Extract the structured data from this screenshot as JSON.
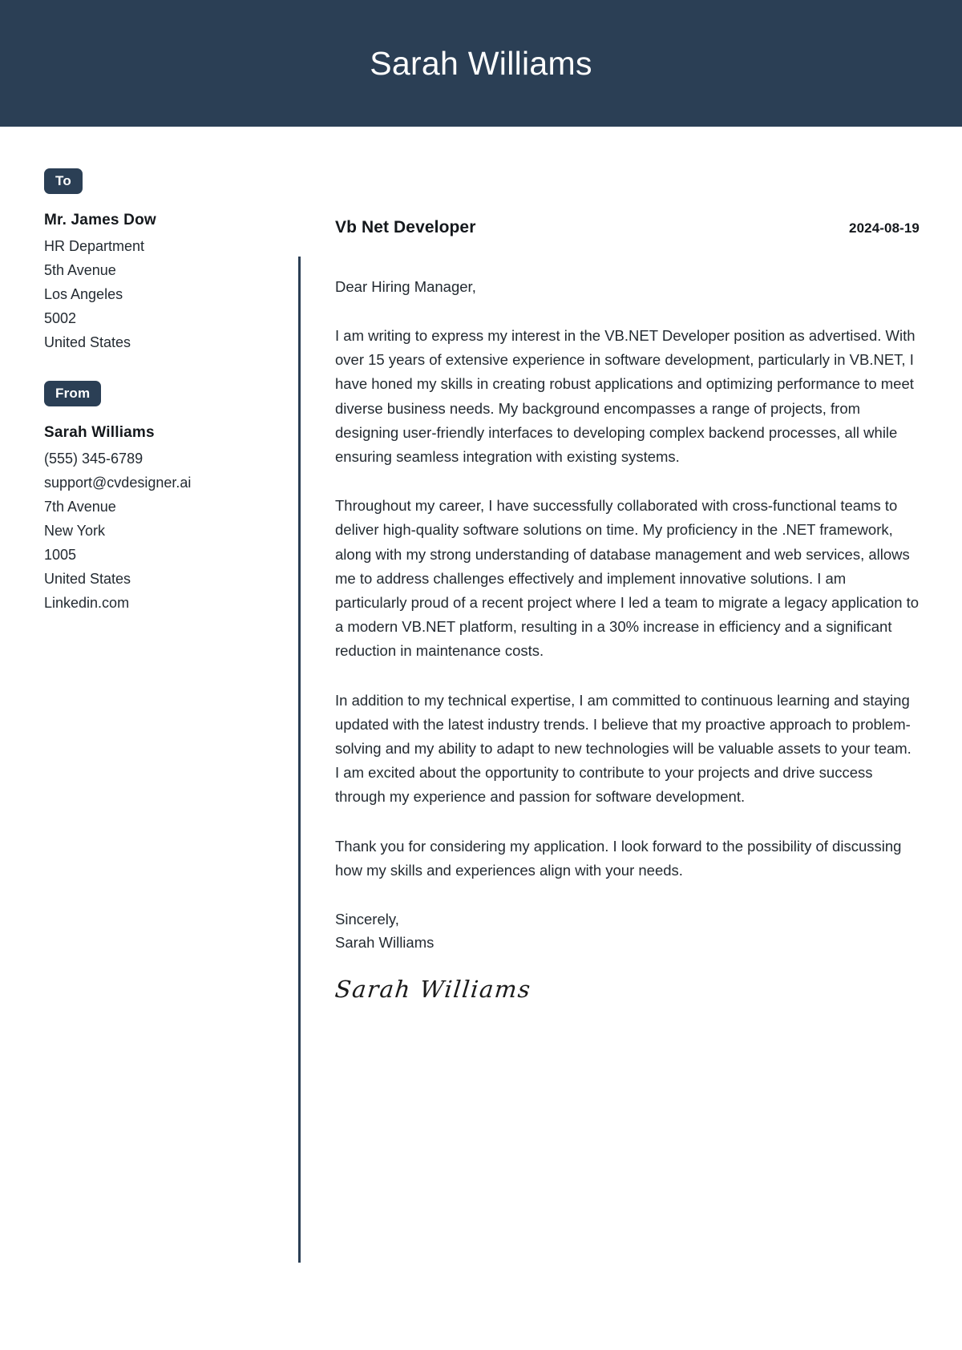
{
  "header": {
    "name": "Sarah Williams",
    "background_color": "#2b3f55",
    "text_color": "#ffffff"
  },
  "sidebar": {
    "to": {
      "badge_label": "To",
      "name": "Mr. James Dow",
      "lines": [
        "HR Department",
        "5th Avenue",
        "Los Angeles",
        "5002",
        "United States"
      ]
    },
    "from": {
      "badge_label": "From",
      "name": "Sarah Williams",
      "lines": [
        "(555) 345-6789",
        "support@cvdesigner.ai",
        "7th Avenue",
        "New York",
        "1005",
        "United States",
        "Linkedin.com"
      ]
    }
  },
  "letter": {
    "job_title": "Vb Net Developer",
    "date": "2024-08-19",
    "salutation": "Dear Hiring Manager,",
    "paragraphs": [
      "I am writing to express my interest in the VB.NET Developer position as advertised. With over 15 years of extensive experience in software development, particularly in VB.NET, I have honed my skills in creating robust applications and optimizing performance to meet diverse business needs. My background encompasses a range of projects, from designing user-friendly interfaces to developing complex backend processes, all while ensuring seamless integration with existing systems.",
      "Throughout my career, I have successfully collaborated with cross-functional teams to deliver high-quality software solutions on time. My proficiency in the .NET framework, along with my strong understanding of database management and web services, allows me to address challenges effectively and implement innovative solutions. I am particularly proud of a recent project where I led a team to migrate a legacy application to a modern VB.NET platform, resulting in a 30% increase in efficiency and a significant reduction in maintenance costs.",
      "In addition to my technical expertise, I am committed to continuous learning and staying updated with the latest industry trends. I believe that my proactive approach to problem-solving and my ability to adapt to new technologies will be valuable assets to your team. I am excited about the opportunity to contribute to your projects and drive success through my experience and passion for software development.",
      "Thank you for considering my application. I look forward to the possibility of discussing how my skills and experiences align with your needs."
    ],
    "closing_word": "Sincerely,",
    "closing_name": "Sarah Williams",
    "signature": "Sarah Williams"
  }
}
